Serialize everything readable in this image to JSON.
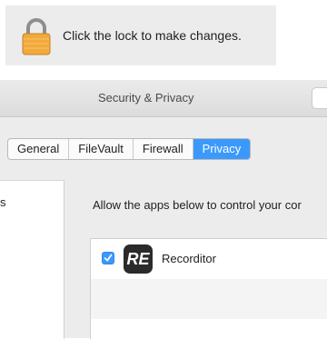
{
  "lock_notice": {
    "text": "Click the lock to make changes.",
    "icon": "lock-icon"
  },
  "window": {
    "title": "Security & Privacy"
  },
  "tabs": [
    {
      "label": "General",
      "selected": false
    },
    {
      "label": "FileVault",
      "selected": false
    },
    {
      "label": "Firewall",
      "selected": false
    },
    {
      "label": "Privacy",
      "selected": true
    }
  ],
  "left_panel": {
    "visible_fragment": "s"
  },
  "main": {
    "allow_text": "Allow the apps below to control your cor",
    "apps": [
      {
        "name": "Recorditor",
        "checked": true,
        "icon": "recorditor-app-icon",
        "icon_text": "RE"
      }
    ]
  },
  "colors": {
    "accent": "#3b99fc",
    "lock_body": "#f0a63a",
    "panel_bg": "#ececec"
  }
}
